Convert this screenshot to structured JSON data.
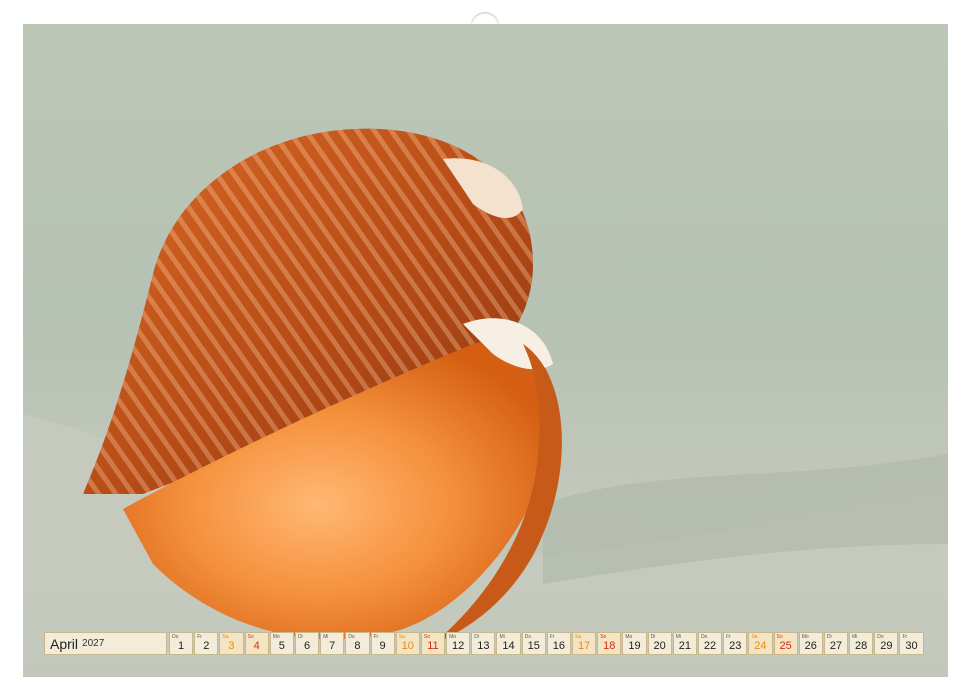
{
  "calendar": {
    "month": "April",
    "year": "2027",
    "weekday_colors": {
      "saturday": "#e48a18",
      "sunday": "#d22c12"
    },
    "days": [
      {
        "dow": "Do",
        "day": "1"
      },
      {
        "dow": "Fr",
        "day": "2"
      },
      {
        "dow": "Sa",
        "day": "3"
      },
      {
        "dow": "So",
        "day": "4"
      },
      {
        "dow": "Mo",
        "day": "5"
      },
      {
        "dow": "Di",
        "day": "6"
      },
      {
        "dow": "Mi",
        "day": "7"
      },
      {
        "dow": "Do",
        "day": "8"
      },
      {
        "dow": "Fr",
        "day": "9"
      },
      {
        "dow": "Sa",
        "day": "10"
      },
      {
        "dow": "So",
        "day": "11"
      },
      {
        "dow": "Mo",
        "day": "12"
      },
      {
        "dow": "Di",
        "day": "13"
      },
      {
        "dow": "Mi",
        "day": "14"
      },
      {
        "dow": "Do",
        "day": "15"
      },
      {
        "dow": "Fr",
        "day": "16"
      },
      {
        "dow": "Sa",
        "day": "17"
      },
      {
        "dow": "So",
        "day": "18"
      },
      {
        "dow": "Mo",
        "day": "19"
      },
      {
        "dow": "Di",
        "day": "20"
      },
      {
        "dow": "Mi",
        "day": "21"
      },
      {
        "dow": "Do",
        "day": "22"
      },
      {
        "dow": "Fr",
        "day": "23"
      },
      {
        "dow": "Sa",
        "day": "24"
      },
      {
        "dow": "So",
        "day": "25"
      },
      {
        "dow": "Mo",
        "day": "26"
      },
      {
        "dow": "Di",
        "day": "27"
      },
      {
        "dow": "Mi",
        "day": "28"
      },
      {
        "dow": "Do",
        "day": "29"
      },
      {
        "dow": "Fr",
        "day": "30"
      }
    ]
  },
  "photo": {
    "subject": "seashell-on-sand",
    "colors": {
      "sand": "#b9c4b6",
      "shell": "#e26a1c",
      "shell_inner": "#f59a48"
    }
  }
}
